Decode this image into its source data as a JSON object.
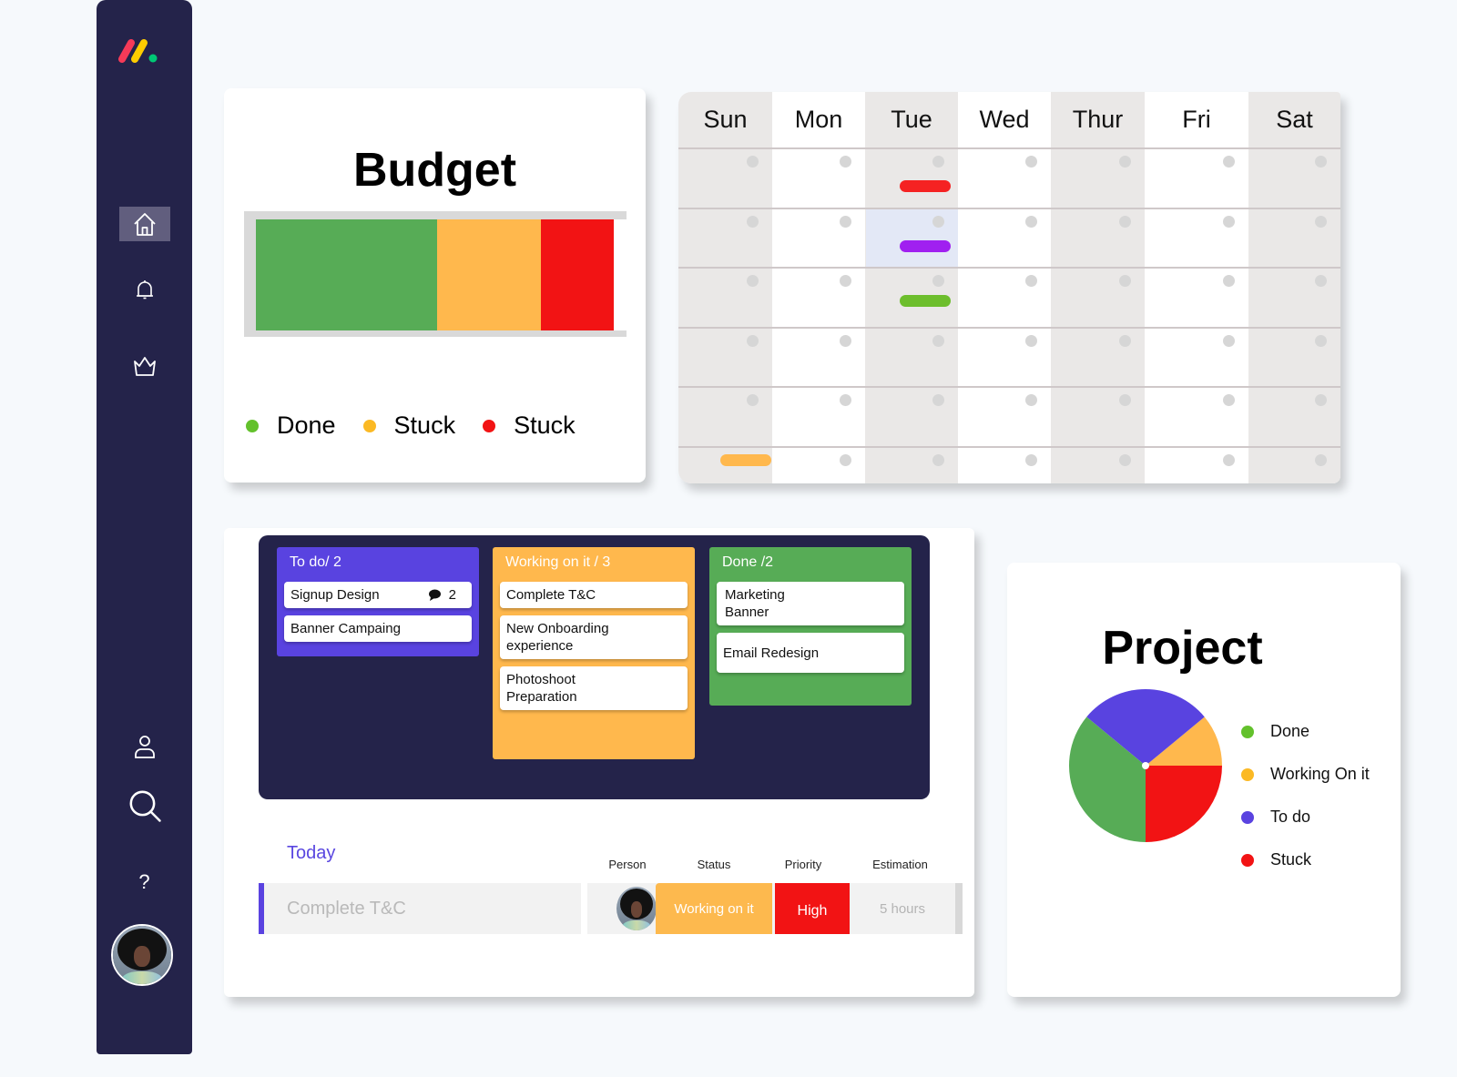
{
  "sidebar": {
    "logo_colors": [
      "#f63a58",
      "#ffcc00",
      "#00c875"
    ],
    "nav": [
      {
        "name": "home",
        "icon": "home-icon",
        "active": true
      },
      {
        "name": "notifications",
        "icon": "bell-icon",
        "active": false
      },
      {
        "name": "upgrade",
        "icon": "crown-icon",
        "active": false
      },
      {
        "name": "profile",
        "icon": "person-icon",
        "active": false
      },
      {
        "name": "search",
        "icon": "search-icon",
        "active": false
      }
    ],
    "help_label": "?",
    "avatar_alt": "User avatar"
  },
  "budget": {
    "title": "Budget",
    "segments": [
      {
        "label": "Done",
        "color": "#57ac56",
        "fraction": 0.49
      },
      {
        "label": "Stuck",
        "color": "#ffb84d",
        "fraction": 0.28
      },
      {
        "label": "Stuck",
        "color": "#f21314",
        "fraction": 0.195
      }
    ],
    "legend": [
      {
        "label": "Done",
        "color": "#63c12c"
      },
      {
        "label": "Stuck",
        "color": "#fbb924"
      },
      {
        "label": "Stuck",
        "color": "#f21314"
      }
    ]
  },
  "calendar": {
    "days": [
      "Sun",
      "Mon",
      "Tue",
      "Wed",
      "Thur",
      "Fri",
      "Sat"
    ],
    "shaded_days": [
      0,
      2,
      4,
      6
    ],
    "weeks": 6,
    "highlight": {
      "week": 1,
      "day": 2
    },
    "events": [
      {
        "week": 0,
        "day": 2,
        "color": "#f52222"
      },
      {
        "week": 1,
        "day": 2,
        "color": "#a020f0"
      },
      {
        "week": 2,
        "day": 2,
        "color": "#6dbe2d"
      },
      {
        "week": 5,
        "day": 0,
        "color": "#ffb84d"
      }
    ]
  },
  "board": {
    "columns": [
      {
        "title": "To do/ 2",
        "color": "#5943e0",
        "tasks": [
          {
            "title": "Signup Design",
            "comments": "2"
          },
          {
            "title": "Banner Campaing"
          }
        ]
      },
      {
        "title": "Working on it / 3",
        "color": "#ffb84d",
        "tasks": [
          {
            "title": "Complete T&C"
          },
          {
            "title": "New Onboarding experience"
          },
          {
            "title": "Photoshoot Preparation"
          }
        ]
      },
      {
        "title": "Done /2",
        "color": "#57ac56",
        "tasks": [
          {
            "title": "Marketing Banner"
          },
          {
            "title": "Email Redesign"
          }
        ]
      }
    ]
  },
  "today": {
    "label": "Today",
    "columns": [
      "Person",
      "Status",
      "Priority",
      "Estimation"
    ],
    "row": {
      "name": "Complete T&C",
      "status": "Working on it",
      "priority": "High",
      "estimation": "5 hours"
    }
  },
  "project": {
    "title": "Project",
    "legend": [
      {
        "label": "Done",
        "color": "#63c12c"
      },
      {
        "label": "Working On it",
        "color": "#fbb924"
      },
      {
        "label": "To do",
        "color": "#5a43e0"
      },
      {
        "label": "Stuck",
        "color": "#f21314"
      }
    ]
  },
  "chart_data": [
    {
      "type": "bar",
      "title": "Budget",
      "orientation": "horizontal-stacked",
      "categories": [
        "Done",
        "Stuck",
        "Stuck"
      ],
      "values": [
        49,
        28,
        19.5
      ],
      "unit": "percent",
      "colors": [
        "#57ac56",
        "#ffb84d",
        "#f21314"
      ]
    },
    {
      "type": "pie",
      "title": "Project",
      "categories": [
        "Done",
        "Working On it",
        "To do",
        "Stuck"
      ],
      "values": [
        36,
        11,
        28,
        25
      ],
      "unit": "percent",
      "colors": [
        "#57ac56",
        "#ffb84d",
        "#5943e0",
        "#f21314"
      ],
      "legend": "right"
    }
  ]
}
